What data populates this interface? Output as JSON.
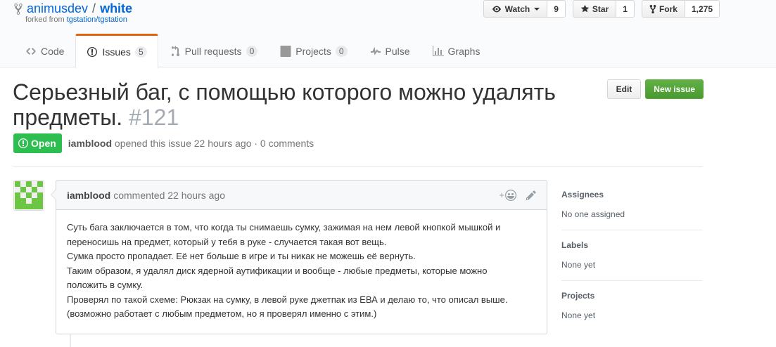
{
  "repo": {
    "owner": "animusdev",
    "separator": "/",
    "name": "white",
    "forked_prefix": "forked from ",
    "forked_source": "tgstation/tgstation"
  },
  "actions": {
    "watch": {
      "label": "Watch",
      "count": "9"
    },
    "star": {
      "label": "Star",
      "count": "1"
    },
    "fork": {
      "label": "Fork",
      "count": "1,275"
    }
  },
  "nav": {
    "code": {
      "label": "Code"
    },
    "issues": {
      "label": "Issues",
      "count": "5"
    },
    "pulls": {
      "label": "Pull requests",
      "count": "0"
    },
    "projects": {
      "label": "Projects",
      "count": "0"
    },
    "pulse": {
      "label": "Pulse"
    },
    "graphs": {
      "label": "Graphs"
    }
  },
  "issue": {
    "title": "Серьезный баг, с помощью которого можно удалять предметы.",
    "number": "#121",
    "edit_label": "Edit",
    "new_label": "New issue",
    "state": "Open",
    "author": "iamblood",
    "meta_text": "opened this issue 22 hours ago · 0 comments"
  },
  "comment": {
    "author": "iamblood",
    "meta_text": "commented 22 hours ago",
    "reaction_label": "+",
    "lines": [
      "Суть бага заключается в том, что когда ты снимаешь сумку, зажимая на нем левой кнопкой мышкой и",
      "переносишь на предмет, который у тебя в руке - случается такая вот вещь.",
      "Сумка просто пропадает. Её нет больше в игре и ты никак не можешь её вернуть.",
      "Таким образом, я удалял диск ядерной аутификации и вообще - любые предметы, которые можно",
      "положить в сумку.",
      "Проверял по такой схеме: Рюкзак на сумку, в левой руке джетпак из ЕВА и делаю то, что описал выше.",
      "(возможно работает с любым предметом, но я проверял именно с этим.)"
    ]
  },
  "sidebar": {
    "assignees": {
      "title": "Assignees",
      "value": "No one assigned"
    },
    "labels": {
      "title": "Labels",
      "value": "None yet"
    },
    "projects": {
      "title": "Projects",
      "value": "None yet"
    }
  }
}
